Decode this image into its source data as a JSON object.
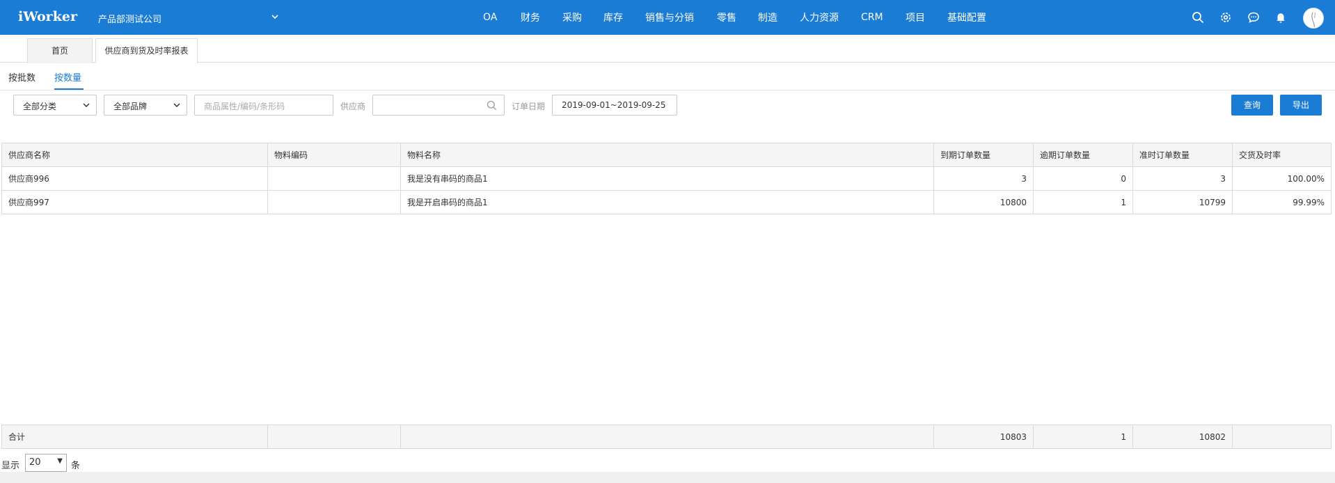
{
  "topbar": {
    "logo": "iWorker",
    "company": "产品部测试公司",
    "nav": [
      "OA",
      "财务",
      "采购",
      "库存",
      "销售与分销",
      "零售",
      "制造",
      "人力资源",
      "CRM",
      "项目",
      "基础配置"
    ]
  },
  "page_tabs": [
    "首页",
    "供应商到货及时率报表"
  ],
  "sub_tabs": [
    "按批数",
    "按数量"
  ],
  "filters": {
    "category": "全部分类",
    "brand": "全部品牌",
    "product_placeholder": "商品属性/编码/条形码",
    "supplier_label": "供应商",
    "date_label": "订单日期",
    "date_range": "2019-09-01~2019-09-25",
    "query_button": "查询",
    "export_button": "导出"
  },
  "table": {
    "columns": [
      "供应商名称",
      "物料编码",
      "物料名称",
      "到期订单数量",
      "逾期订单数量",
      "准时订单数量",
      "交货及时率"
    ],
    "rows": [
      [
        "供应商996",
        "",
        "我是没有串码的商品1",
        "3",
        "0",
        "3",
        "100.00%"
      ],
      [
        "供应商997",
        "",
        "我是开启串码的商品1",
        "10800",
        "1",
        "10799",
        "99.99%"
      ]
    ],
    "footer": [
      "合计",
      "",
      "",
      "10803",
      "1",
      "10802",
      ""
    ]
  },
  "pager": {
    "label": "显示",
    "value": "20",
    "unit": "条"
  }
}
